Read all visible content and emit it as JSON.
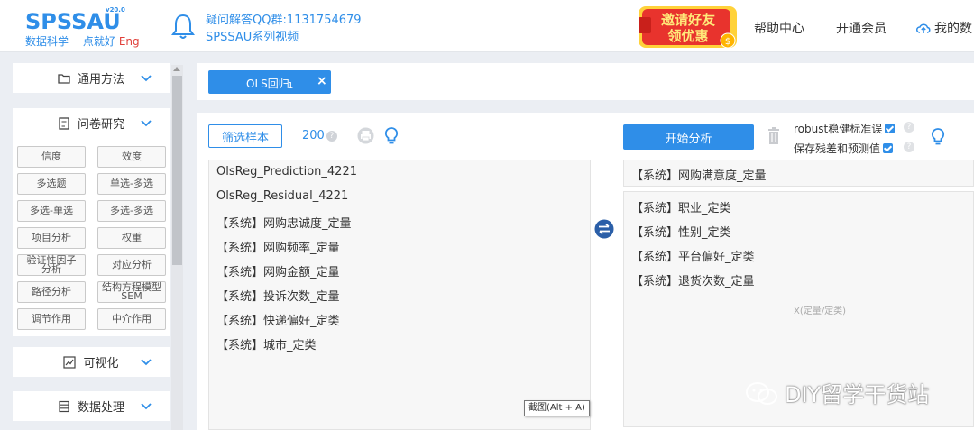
{
  "header": {
    "logo_text": "SPSSAU",
    "logo_version": "v20.0",
    "logo_slogan": "数据科学 一点就好",
    "logo_lang": "Eng",
    "qq_line1": "疑问解答QQ群:1131754679",
    "qq_line2": "SPSSAU系列视频",
    "invite_line1": "邀请好友",
    "invite_line2": "领优惠",
    "nav_help": "帮助中心",
    "nav_vip": "开通会员",
    "nav_mine": "我的数"
  },
  "sidebar": {
    "sections": {
      "general": "通用方法",
      "survey": "问卷研究",
      "visual": "可视化",
      "data": "数据处理"
    },
    "survey_buttons": [
      "信度",
      "效度",
      "多选题",
      "单选-多选",
      "多选-单选",
      "多选-多选",
      "项目分析",
      "权重",
      "验证性因子分析",
      "对应分析",
      "路径分析",
      "结构方程模型SEM",
      "调节作用",
      "中介作用"
    ],
    "survey_buttons_split": {
      "cfa_1": "验证性因子",
      "cfa_2": "分析",
      "sem_1": "结构方程模型",
      "sem_2": "SEM"
    }
  },
  "tabs": {
    "active": "OLS回归",
    "badge": "1",
    "close": "×"
  },
  "toolbar": {
    "filter_label": "筛选样本",
    "sample_count": "200",
    "help_mark": "?",
    "start_label": "开始分析",
    "robust_label": "robust稳健标准误",
    "robust_checked": true,
    "save_label": "保存残差和预测值",
    "save_checked": true
  },
  "variables": {
    "left": [
      "OlsReg_Prediction_4221",
      "OlsReg_Residual_4221",
      "【系统】网购忠诚度_定量",
      "【系统】网购频率_定量",
      "【系统】网购金额_定量",
      "【系统】投诉次数_定量",
      "【系统】快递偏好_定类",
      "【系统】城市_定类"
    ],
    "y": "【系统】网购满意度_定量",
    "x": [
      "【系统】职业_定类",
      "【系统】性别_定类",
      "【系统】平台偏好_定类",
      "【系统】退货次数_定量"
    ],
    "x_hint": "X(定量/定类)"
  },
  "tooltip": "截图(Alt + A)",
  "watermark": "DIY留学干货站",
  "colors": {
    "accent": "#2f8ee8",
    "background": "#ebeef3"
  }
}
